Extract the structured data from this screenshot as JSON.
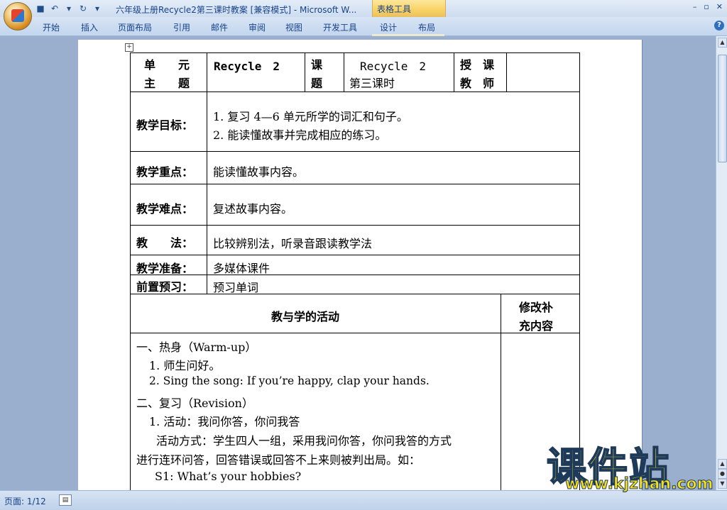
{
  "window": {
    "title": "六年级上册Recycle2第三课时教案 [兼容模式] - Microsoft W...",
    "context_tab_group": "表格工具",
    "controls": [
      "–",
      "▫",
      "✕"
    ]
  },
  "ribbon": {
    "tabs": [
      "开始",
      "插入",
      "页面布局",
      "引用",
      "邮件",
      "审阅",
      "视图",
      "开发工具",
      "设计",
      "布局"
    ]
  },
  "table": {
    "r1": {
      "unit_label_1": "单　　元",
      "unit_label_2": "主　　题",
      "unit_value": "Recycle　2",
      "lesson_label_1": "课",
      "lesson_label_2": "题",
      "lesson_value_1": "Recycle　2",
      "lesson_value_2": "第三课时",
      "teacher_label_1": "授　课",
      "teacher_label_2": "教　师"
    },
    "goal_label": "教学目标：",
    "goal_1": "1. 复习 4—6 单元所学的词汇和句子。",
    "goal_2": "2. 能读懂故事并完成相应的练习。",
    "key_label": "教学重点：",
    "key_value": "能读懂故事内容。",
    "diff_label": "教学难点：",
    "diff_value": "复述故事内容。",
    "method_label": "教　　法：",
    "method_value": "比较辨别法，听录音跟读教学法",
    "prep_label": "教学准备：",
    "prep_value": "多媒体课件",
    "preview_label": "前置预习：",
    "preview_value": "预习单词",
    "activities_header": "教与学的活动",
    "notes_header_1": "修改补",
    "notes_header_2": "充内容",
    "lines": [
      "一、热身（Warm-up）",
      "1. 师生问好。",
      "2. Sing the song: If you’re happy, clap your hands.",
      "二、复习（Revision）",
      "1. 活动：我问你答，你问我答",
      "活动方式：学生四人一组，采用我问你答，你问我答的方式",
      "进行连环问答，回答错误或回答不上来则被判出局。如：",
      "S1: What’s your hobbies?"
    ]
  },
  "status": {
    "page": "页面: 1/12"
  },
  "watermark": {
    "main": "课件站",
    "url": "www.kjzhan.com"
  }
}
